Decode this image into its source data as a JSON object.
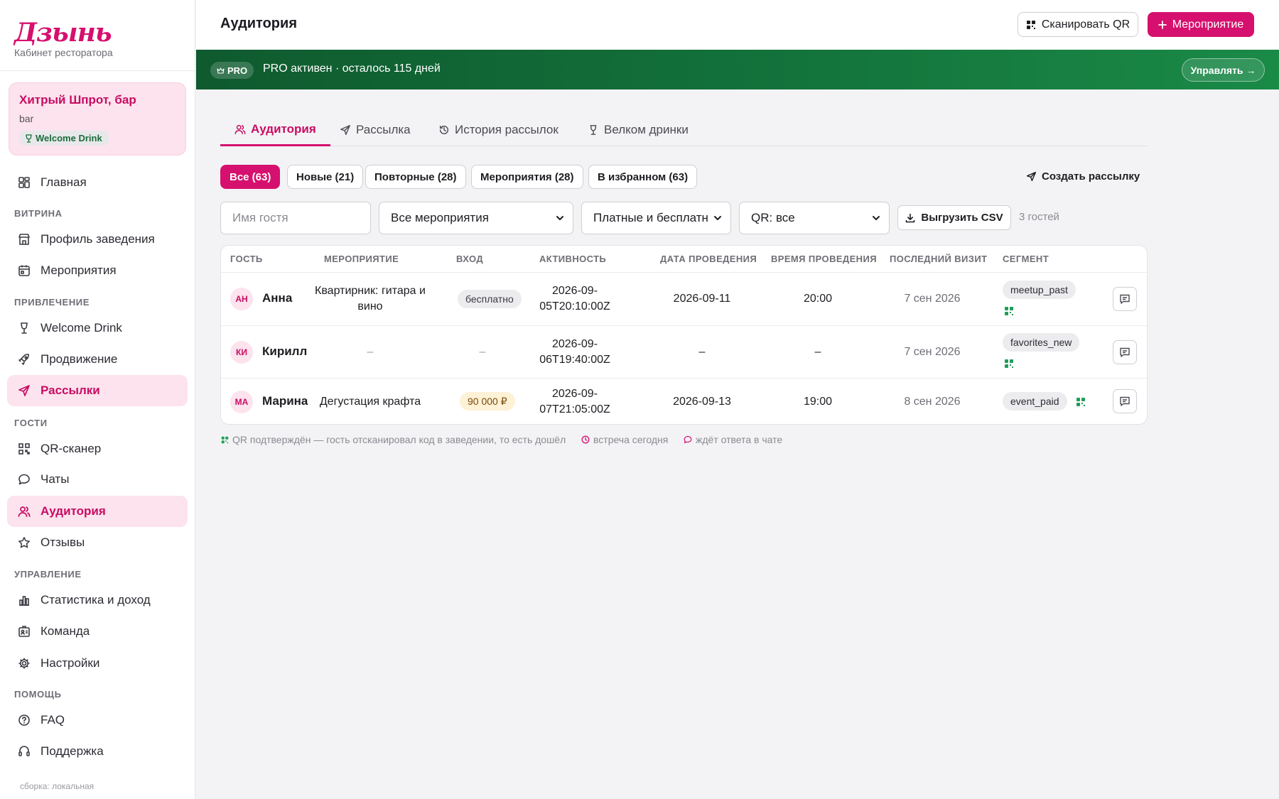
{
  "brand": {
    "logo": "Дзынь",
    "subtitle": "Кабинет ресторатора"
  },
  "venue": {
    "name": "Хитрый Шпрот, бар",
    "type": "bar",
    "badge": "Welcome Drink"
  },
  "nav": {
    "sections": {
      "showcase": "ВИТРИНА",
      "attraction": "ПРИВЛЕЧЕНИЕ",
      "guests": "ГОСТИ",
      "management": "УПРАВЛЕНИЕ",
      "help": "ПОМОЩЬ"
    },
    "items": {
      "home": "Главная",
      "profile": "Профиль заведения",
      "events": "Мероприятия",
      "welcome_drink": "Welcome Drink",
      "promotion": "Продвижение",
      "mailings": "Рассылки",
      "qr_scanner": "QR-сканер",
      "chats": "Чаты",
      "audience": "Аудитория",
      "reviews": "Отзывы",
      "stats": "Статистика и доход",
      "team": "Команда",
      "settings": "Настройки",
      "faq": "FAQ",
      "support": "Поддержка"
    },
    "build": "сборка: локальная"
  },
  "header": {
    "title": "Аудитория",
    "scan_qr": "Сканировать QR",
    "new_event": "Мероприятие"
  },
  "pro": {
    "pill": "PRO",
    "text": "PRO активен · осталось 115 дней",
    "manage": "Управлять →"
  },
  "tabs": {
    "audience": "Аудитория",
    "mailing": "Рассылка",
    "history": "История рассылок",
    "welcome": "Велком дринки"
  },
  "chips": {
    "all": "Все (63)",
    "new": "Новые (21)",
    "repeat": "Повторные (28)",
    "events": "Мероприятия (28)",
    "favorites": "В избранном (63)"
  },
  "create_mailing": "Создать рассылку",
  "filters": {
    "guest_placeholder": "Имя гостя",
    "events": "Все мероприятия",
    "paid": "Платные и бесплатн",
    "qr": "QR: все",
    "export": "Выгрузить CSV",
    "count": "3 гостей"
  },
  "table": {
    "headers": {
      "guest": "ГОСТЬ",
      "event": "МЕРОПРИЯТИЕ",
      "entry": "ВХОД",
      "activity": "АКТИВНОСТЬ",
      "date": "ДАТА ПРОВЕДЕНИЯ",
      "time": "ВРЕМЯ ПРОВЕДЕНИЯ",
      "last_visit": "ПОСЛЕДНИЙ ВИЗИТ",
      "segment": "СЕГМЕНТ"
    },
    "rows": [
      {
        "initials": "АН",
        "name": "Анна",
        "event_l1": "Квартирник: гитара и",
        "event_l2": "вино",
        "entry": "бесплатно",
        "activity_l1": "2026-09-",
        "activity_l2": "05T20:10:00Z",
        "date": "2026-09-11",
        "time": "20:00",
        "last_visit": "7 сен 2026",
        "segment": "meetup_past"
      },
      {
        "initials": "КИ",
        "name": "Кирилл",
        "event": "–",
        "entry": "–",
        "activity_l1": "2026-09-",
        "activity_l2": "06T19:40:00Z",
        "date": "–",
        "time": "–",
        "last_visit": "7 сен 2026",
        "segment": "favorites_new"
      },
      {
        "initials": "МА",
        "name": "Марина",
        "event": "Дегустация крафта",
        "entry": "90 000 ₽",
        "activity_l1": "2026-09-",
        "activity_l2": "07T21:05:00Z",
        "date": "2026-09-13",
        "time": "19:00",
        "last_visit": "8 сен 2026",
        "segment": "event_paid"
      }
    ]
  },
  "legend": {
    "qr": "QR подтверждён — гость отсканировал код в заведении, то есть дошёл",
    "today": "встреча сегодня",
    "waiting": "ждёт ответа в чате"
  },
  "colors": {
    "accent": "#d6106e",
    "accent_soft": "#fce3ee",
    "pro_green": "#13733b",
    "qr_green": "#1e9e5a"
  }
}
